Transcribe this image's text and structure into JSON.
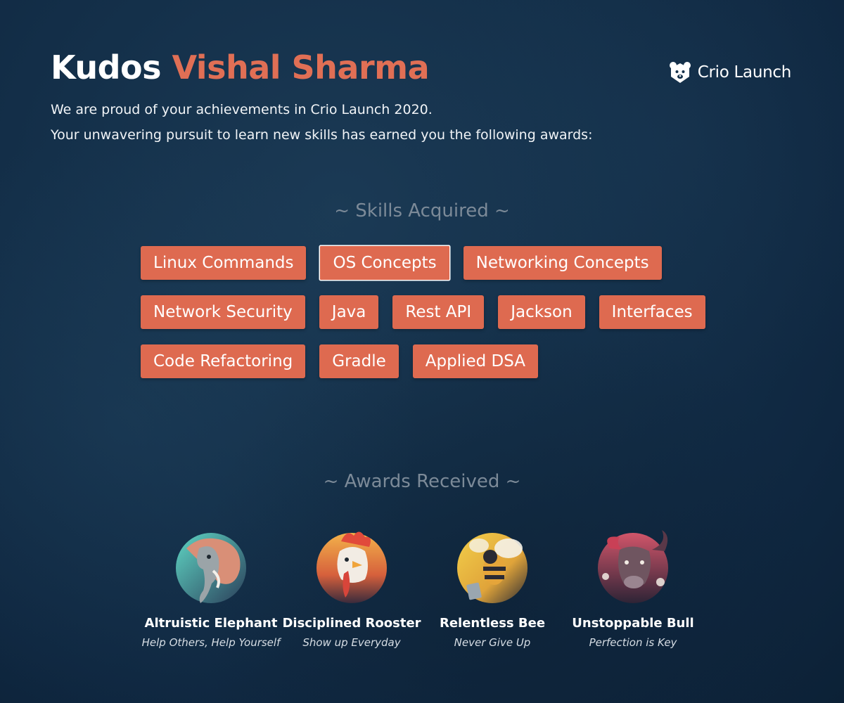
{
  "header": {
    "title_lead": "Kudos",
    "title_name": "Vishal Sharma",
    "line1": "We are proud of your achievements in Crio Launch 2020.",
    "line2": "Your unwavering pursuit to learn new skills has earned you the following awards:"
  },
  "brand": {
    "text": "Crio Launch",
    "icon": "bear-logo-icon"
  },
  "skills": {
    "heading": "~ Skills Acquired ~",
    "rows": [
      [
        "Linux Commands",
        "OS Concepts",
        "Networking Concepts"
      ],
      [
        "Network Security",
        "Java",
        "Rest API",
        "Jackson",
        "Interfaces"
      ],
      [
        "Code Refactoring",
        "Gradle",
        "Applied DSA"
      ]
    ],
    "highlighted": "OS Concepts"
  },
  "awards": {
    "heading": "~ Awards Received ~",
    "items": [
      {
        "name": "Altruistic Elephant",
        "tagline": "Help Others, Help Yourself",
        "icon": "elephant-badge-icon"
      },
      {
        "name": "Disciplined Rooster",
        "tagline": "Show up Everyday",
        "icon": "rooster-badge-icon"
      },
      {
        "name": "Relentless Bee",
        "tagline": "Never Give Up",
        "icon": "bee-badge-icon"
      },
      {
        "name": "Unstoppable Bull",
        "tagline": "Perfection is Key",
        "icon": "bull-badge-icon"
      }
    ]
  },
  "colors": {
    "accent": "#e06f55",
    "chip": "#de6a50",
    "background": "#14304a",
    "muted_heading": "#7c8a98"
  }
}
